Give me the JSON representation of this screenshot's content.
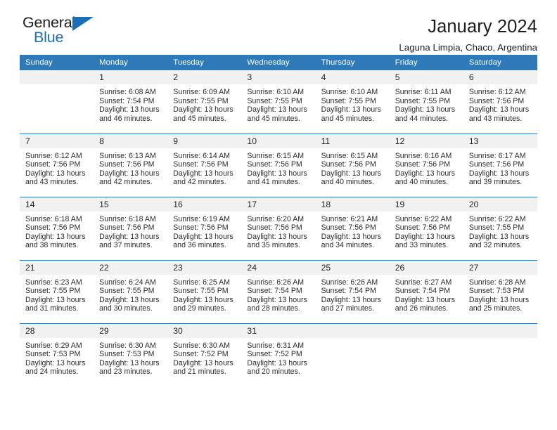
{
  "brand": {
    "name_top": "General",
    "name_bottom": "Blue",
    "accent_color": "#1b6fb5",
    "triangle_icon": "triangle-icon"
  },
  "header": {
    "title": "January 2024",
    "subtitle": "Laguna Limpia, Chaco, Argentina"
  },
  "theme": {
    "header_bg": "#2e7ab8",
    "daynum_bg": "#f1f1f1",
    "text": "#262626"
  },
  "calendar": {
    "weekday_headers": [
      "Sunday",
      "Monday",
      "Tuesday",
      "Wednesday",
      "Thursday",
      "Friday",
      "Saturday"
    ],
    "labels": {
      "sunrise": "Sunrise:",
      "sunset": "Sunset:",
      "daylight": "Daylight:"
    },
    "weeks": [
      [
        {
          "day": "",
          "blank": true
        },
        {
          "day": "1",
          "sunrise": "Sunrise: 6:08 AM",
          "sunset": "Sunset: 7:54 PM",
          "daylight1": "Daylight: 13 hours",
          "daylight2": "and 46 minutes."
        },
        {
          "day": "2",
          "sunrise": "Sunrise: 6:09 AM",
          "sunset": "Sunset: 7:55 PM",
          "daylight1": "Daylight: 13 hours",
          "daylight2": "and 45 minutes."
        },
        {
          "day": "3",
          "sunrise": "Sunrise: 6:10 AM",
          "sunset": "Sunset: 7:55 PM",
          "daylight1": "Daylight: 13 hours",
          "daylight2": "and 45 minutes."
        },
        {
          "day": "4",
          "sunrise": "Sunrise: 6:10 AM",
          "sunset": "Sunset: 7:55 PM",
          "daylight1": "Daylight: 13 hours",
          "daylight2": "and 45 minutes."
        },
        {
          "day": "5",
          "sunrise": "Sunrise: 6:11 AM",
          "sunset": "Sunset: 7:55 PM",
          "daylight1": "Daylight: 13 hours",
          "daylight2": "and 44 minutes."
        },
        {
          "day": "6",
          "sunrise": "Sunrise: 6:12 AM",
          "sunset": "Sunset: 7:56 PM",
          "daylight1": "Daylight: 13 hours",
          "daylight2": "and 43 minutes."
        }
      ],
      [
        {
          "day": "7",
          "sunrise": "Sunrise: 6:12 AM",
          "sunset": "Sunset: 7:56 PM",
          "daylight1": "Daylight: 13 hours",
          "daylight2": "and 43 minutes."
        },
        {
          "day": "8",
          "sunrise": "Sunrise: 6:13 AM",
          "sunset": "Sunset: 7:56 PM",
          "daylight1": "Daylight: 13 hours",
          "daylight2": "and 42 minutes."
        },
        {
          "day": "9",
          "sunrise": "Sunrise: 6:14 AM",
          "sunset": "Sunset: 7:56 PM",
          "daylight1": "Daylight: 13 hours",
          "daylight2": "and 42 minutes."
        },
        {
          "day": "10",
          "sunrise": "Sunrise: 6:15 AM",
          "sunset": "Sunset: 7:56 PM",
          "daylight1": "Daylight: 13 hours",
          "daylight2": "and 41 minutes."
        },
        {
          "day": "11",
          "sunrise": "Sunrise: 6:15 AM",
          "sunset": "Sunset: 7:56 PM",
          "daylight1": "Daylight: 13 hours",
          "daylight2": "and 40 minutes."
        },
        {
          "day": "12",
          "sunrise": "Sunrise: 6:16 AM",
          "sunset": "Sunset: 7:56 PM",
          "daylight1": "Daylight: 13 hours",
          "daylight2": "and 40 minutes."
        },
        {
          "day": "13",
          "sunrise": "Sunrise: 6:17 AM",
          "sunset": "Sunset: 7:56 PM",
          "daylight1": "Daylight: 13 hours",
          "daylight2": "and 39 minutes."
        }
      ],
      [
        {
          "day": "14",
          "sunrise": "Sunrise: 6:18 AM",
          "sunset": "Sunset: 7:56 PM",
          "daylight1": "Daylight: 13 hours",
          "daylight2": "and 38 minutes."
        },
        {
          "day": "15",
          "sunrise": "Sunrise: 6:18 AM",
          "sunset": "Sunset: 7:56 PM",
          "daylight1": "Daylight: 13 hours",
          "daylight2": "and 37 minutes."
        },
        {
          "day": "16",
          "sunrise": "Sunrise: 6:19 AM",
          "sunset": "Sunset: 7:56 PM",
          "daylight1": "Daylight: 13 hours",
          "daylight2": "and 36 minutes."
        },
        {
          "day": "17",
          "sunrise": "Sunrise: 6:20 AM",
          "sunset": "Sunset: 7:56 PM",
          "daylight1": "Daylight: 13 hours",
          "daylight2": "and 35 minutes."
        },
        {
          "day": "18",
          "sunrise": "Sunrise: 6:21 AM",
          "sunset": "Sunset: 7:56 PM",
          "daylight1": "Daylight: 13 hours",
          "daylight2": "and 34 minutes."
        },
        {
          "day": "19",
          "sunrise": "Sunrise: 6:22 AM",
          "sunset": "Sunset: 7:56 PM",
          "daylight1": "Daylight: 13 hours",
          "daylight2": "and 33 minutes."
        },
        {
          "day": "20",
          "sunrise": "Sunrise: 6:22 AM",
          "sunset": "Sunset: 7:55 PM",
          "daylight1": "Daylight: 13 hours",
          "daylight2": "and 32 minutes."
        }
      ],
      [
        {
          "day": "21",
          "sunrise": "Sunrise: 6:23 AM",
          "sunset": "Sunset: 7:55 PM",
          "daylight1": "Daylight: 13 hours",
          "daylight2": "and 31 minutes."
        },
        {
          "day": "22",
          "sunrise": "Sunrise: 6:24 AM",
          "sunset": "Sunset: 7:55 PM",
          "daylight1": "Daylight: 13 hours",
          "daylight2": "and 30 minutes."
        },
        {
          "day": "23",
          "sunrise": "Sunrise: 6:25 AM",
          "sunset": "Sunset: 7:55 PM",
          "daylight1": "Daylight: 13 hours",
          "daylight2": "and 29 minutes."
        },
        {
          "day": "24",
          "sunrise": "Sunrise: 6:26 AM",
          "sunset": "Sunset: 7:54 PM",
          "daylight1": "Daylight: 13 hours",
          "daylight2": "and 28 minutes."
        },
        {
          "day": "25",
          "sunrise": "Sunrise: 6:26 AM",
          "sunset": "Sunset: 7:54 PM",
          "daylight1": "Daylight: 13 hours",
          "daylight2": "and 27 minutes."
        },
        {
          "day": "26",
          "sunrise": "Sunrise: 6:27 AM",
          "sunset": "Sunset: 7:54 PM",
          "daylight1": "Daylight: 13 hours",
          "daylight2": "and 26 minutes."
        },
        {
          "day": "27",
          "sunrise": "Sunrise: 6:28 AM",
          "sunset": "Sunset: 7:53 PM",
          "daylight1": "Daylight: 13 hours",
          "daylight2": "and 25 minutes."
        }
      ],
      [
        {
          "day": "28",
          "sunrise": "Sunrise: 6:29 AM",
          "sunset": "Sunset: 7:53 PM",
          "daylight1": "Daylight: 13 hours",
          "daylight2": "and 24 minutes."
        },
        {
          "day": "29",
          "sunrise": "Sunrise: 6:30 AM",
          "sunset": "Sunset: 7:53 PM",
          "daylight1": "Daylight: 13 hours",
          "daylight2": "and 23 minutes."
        },
        {
          "day": "30",
          "sunrise": "Sunrise: 6:30 AM",
          "sunset": "Sunset: 7:52 PM",
          "daylight1": "Daylight: 13 hours",
          "daylight2": "and 21 minutes."
        },
        {
          "day": "31",
          "sunrise": "Sunrise: 6:31 AM",
          "sunset": "Sunset: 7:52 PM",
          "daylight1": "Daylight: 13 hours",
          "daylight2": "and 20 minutes."
        },
        {
          "day": "",
          "blank": true
        },
        {
          "day": "",
          "blank": true
        },
        {
          "day": "",
          "blank": true
        }
      ]
    ]
  }
}
